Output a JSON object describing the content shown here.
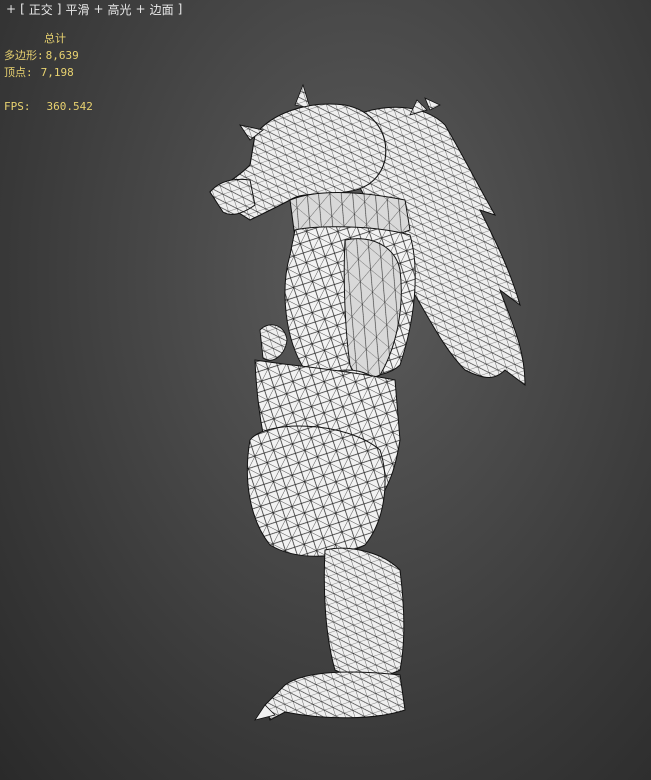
{
  "viewport": {
    "menu": {
      "plus": "+",
      "bracket_open": "[",
      "view_label": "正交",
      "bracket_close_1": "]",
      "shading_label": "平滑",
      "plus_2": "+",
      "highlight_label": "高光",
      "plus_3": "+",
      "edges_label": "边面",
      "bracket_close_2": "]"
    },
    "stats": {
      "title": "总计",
      "polygons_label": "多边形:",
      "polygons_value": "8,639",
      "vertices_label": "顶点:",
      "vertices_value": "7,198",
      "fps_label": "FPS:",
      "fps_value": "360.542"
    },
    "model": {
      "name": "werewolf-wireframe-model"
    }
  },
  "colors": {
    "background_center": "#5c5c5c",
    "background_edge": "#2a2a2a",
    "stats_text": "#e8d270",
    "menu_text": "#e8e8e8",
    "mesh_fill": "#f2f2f2",
    "wire": "#1a1a1a"
  }
}
